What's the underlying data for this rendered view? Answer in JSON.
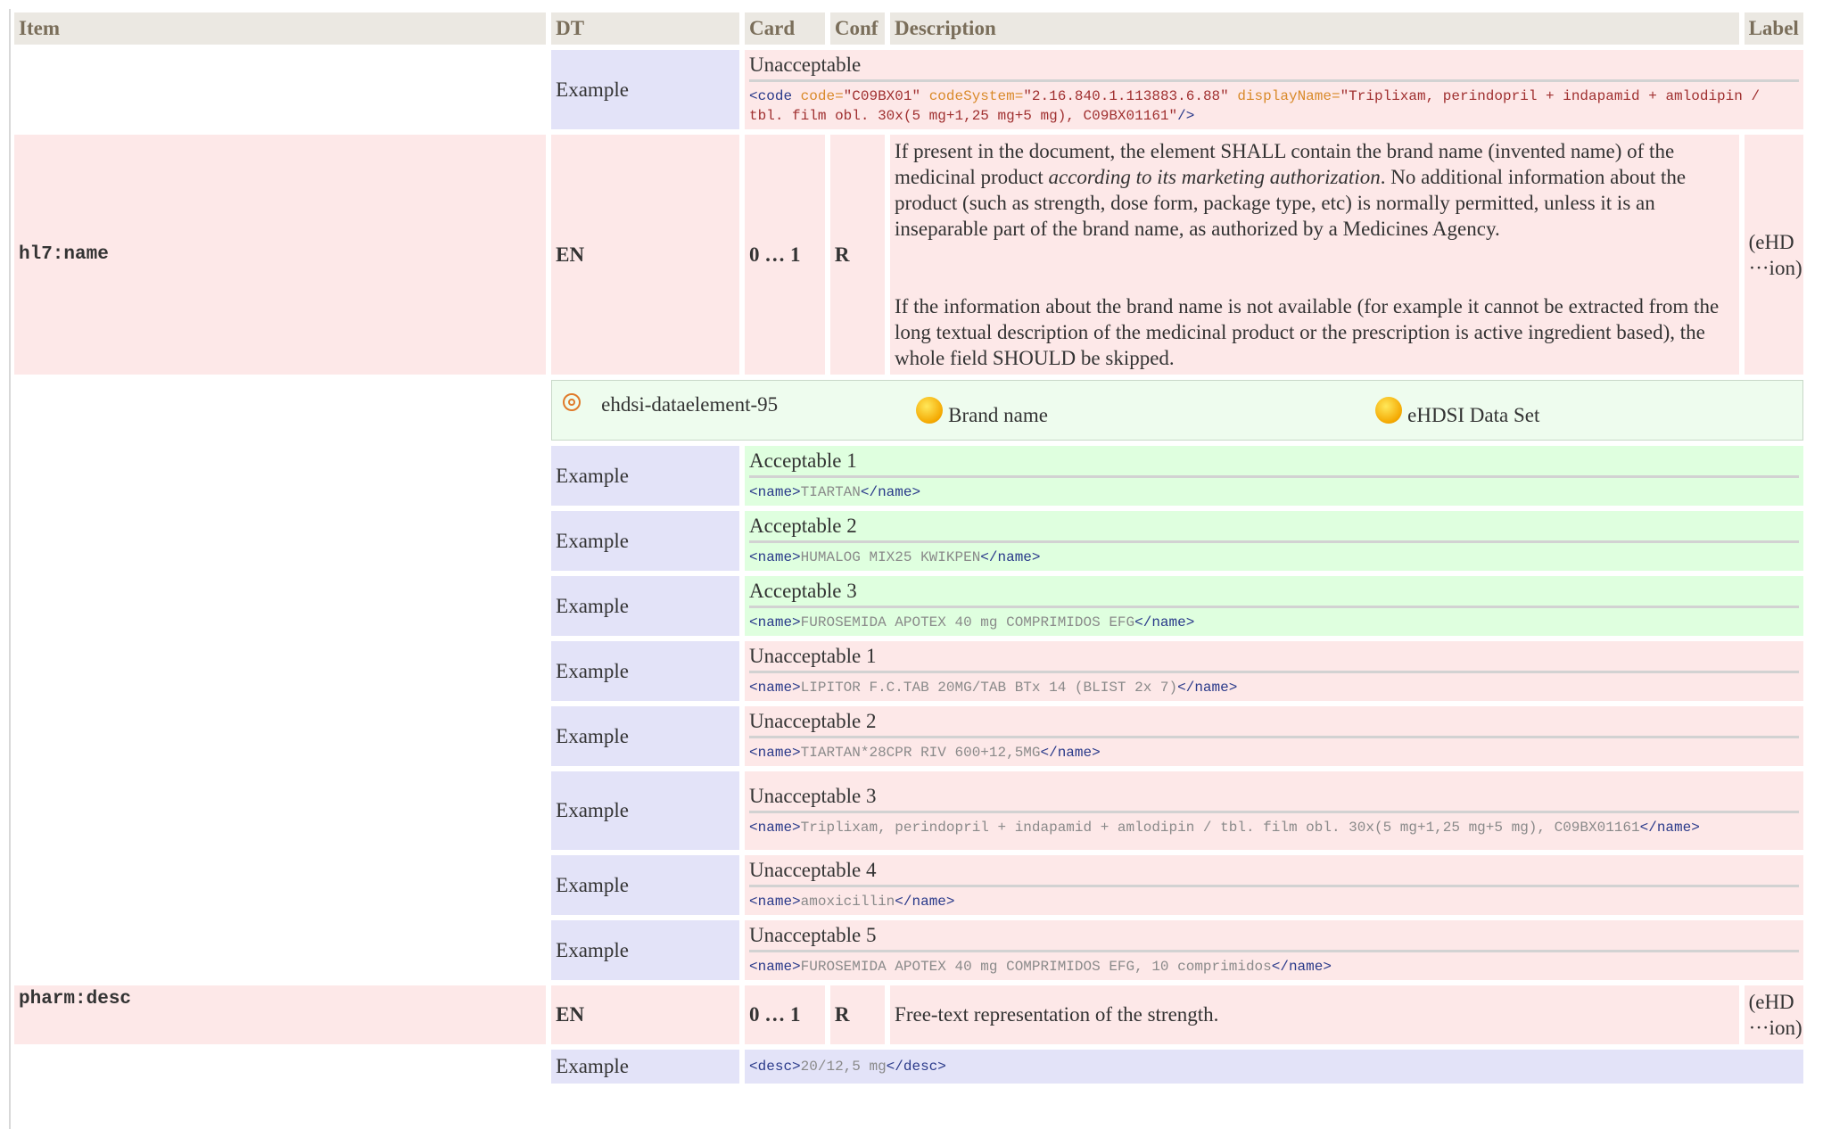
{
  "headers": {
    "item": "Item",
    "dt": "DT",
    "card": "Card",
    "conf": "Conf",
    "description": "Description",
    "label": "Label"
  },
  "example_label": "Example",
  "top_example": {
    "title": "Unacceptable",
    "code_tag_open": "<code",
    "attr1": " code=",
    "val1": "\"C09BX01\"",
    "attr2": " codeSystem=",
    "val2": "\"2.16.840.1.113883.6.88\"",
    "attr3": " displayName=",
    "val3": "\"Triplixam, perindopril + indapamid + amlodipin / tbl. film obl. 30x(5 mg+1,25 mg+5 mg), C09BX01161\"",
    "code_tag_close": "/>"
  },
  "name_row": {
    "item": "hl7:name",
    "dt": "EN",
    "card": "0 … 1",
    "conf": "R",
    "desc_p1_a": "If present in the document, the element SHALL contain the brand name (invented name) of the medicinal product ",
    "desc_p1_em": "according to its marketing authorization",
    "desc_p1_b": ". No additional information about the product (such as strength, dose form, package type, etc) is normally permitted, unless it is an inseparable part of the brand name, as authorized by a Medicines Agency.",
    "desc_p2": "If the information about the brand name is not available (for example it cannot be extracted from the long textual description of the medicinal product or the prescription is active ingredient based), the whole field SHOULD be skipped.",
    "label_line1": "(eHD",
    "label_line2": "···ion)"
  },
  "concept": {
    "id": "ehdsi-dataelement-95",
    "name": "Brand name",
    "dataset": "eHDSI Data Set"
  },
  "name_examples": [
    {
      "title": "Acceptable 1",
      "open": "<name>",
      "text": "TIARTAN",
      "close": "</name>"
    },
    {
      "title": "Acceptable 2",
      "open": "<name>",
      "text": "HUMALOG MIX25 KWIKPEN",
      "close": "</name>"
    },
    {
      "title": "Acceptable 3",
      "open": "<name>",
      "text": "FUROSEMIDA APOTEX 40 mg COMPRIMIDOS EFG",
      "close": "</name>"
    },
    {
      "title": "Unacceptable 1",
      "open": "<name>",
      "text": "LIPITOR F.C.TAB 20MG/TAB BTx 14 (BLIST 2x 7)",
      "close": "</name>"
    },
    {
      "title": "Unacceptable 2",
      "open": "<name>",
      "text": "TIARTAN*28CPR RIV 600+12,5MG",
      "close": "</name>"
    },
    {
      "title": "Unacceptable 3",
      "open": "<name>",
      "text": "Triplixam, perindopril + indapamid + amlodipin / tbl. film obl. 30x(5 mg+1,25 mg+5 mg), C09BX01161",
      "close": "</name>"
    },
    {
      "title": "Unacceptable 4",
      "open": "<name>",
      "text": "amoxicillin",
      "close": "</name>"
    },
    {
      "title": "Unacceptable 5",
      "open": "<name>",
      "text": "FUROSEMIDA APOTEX 40 mg COMPRIMIDOS EFG, 10 comprimidos",
      "close": "</name>"
    }
  ],
  "desc_row": {
    "item": "pharm:desc",
    "dt": "EN",
    "card": "0 … 1",
    "conf": "R",
    "description": "Free-text representation of the strength.",
    "label_line1": "(eHD",
    "label_line2": "···ion)"
  },
  "desc_example": {
    "open": "<desc>",
    "text": "20/12,5 mg",
    "close": "</desc>"
  },
  "colors": {
    "pink": "#fde8e8",
    "green": "#dfffdf",
    "lavender": "#e3e3f8",
    "header": "#ebe8e2"
  }
}
